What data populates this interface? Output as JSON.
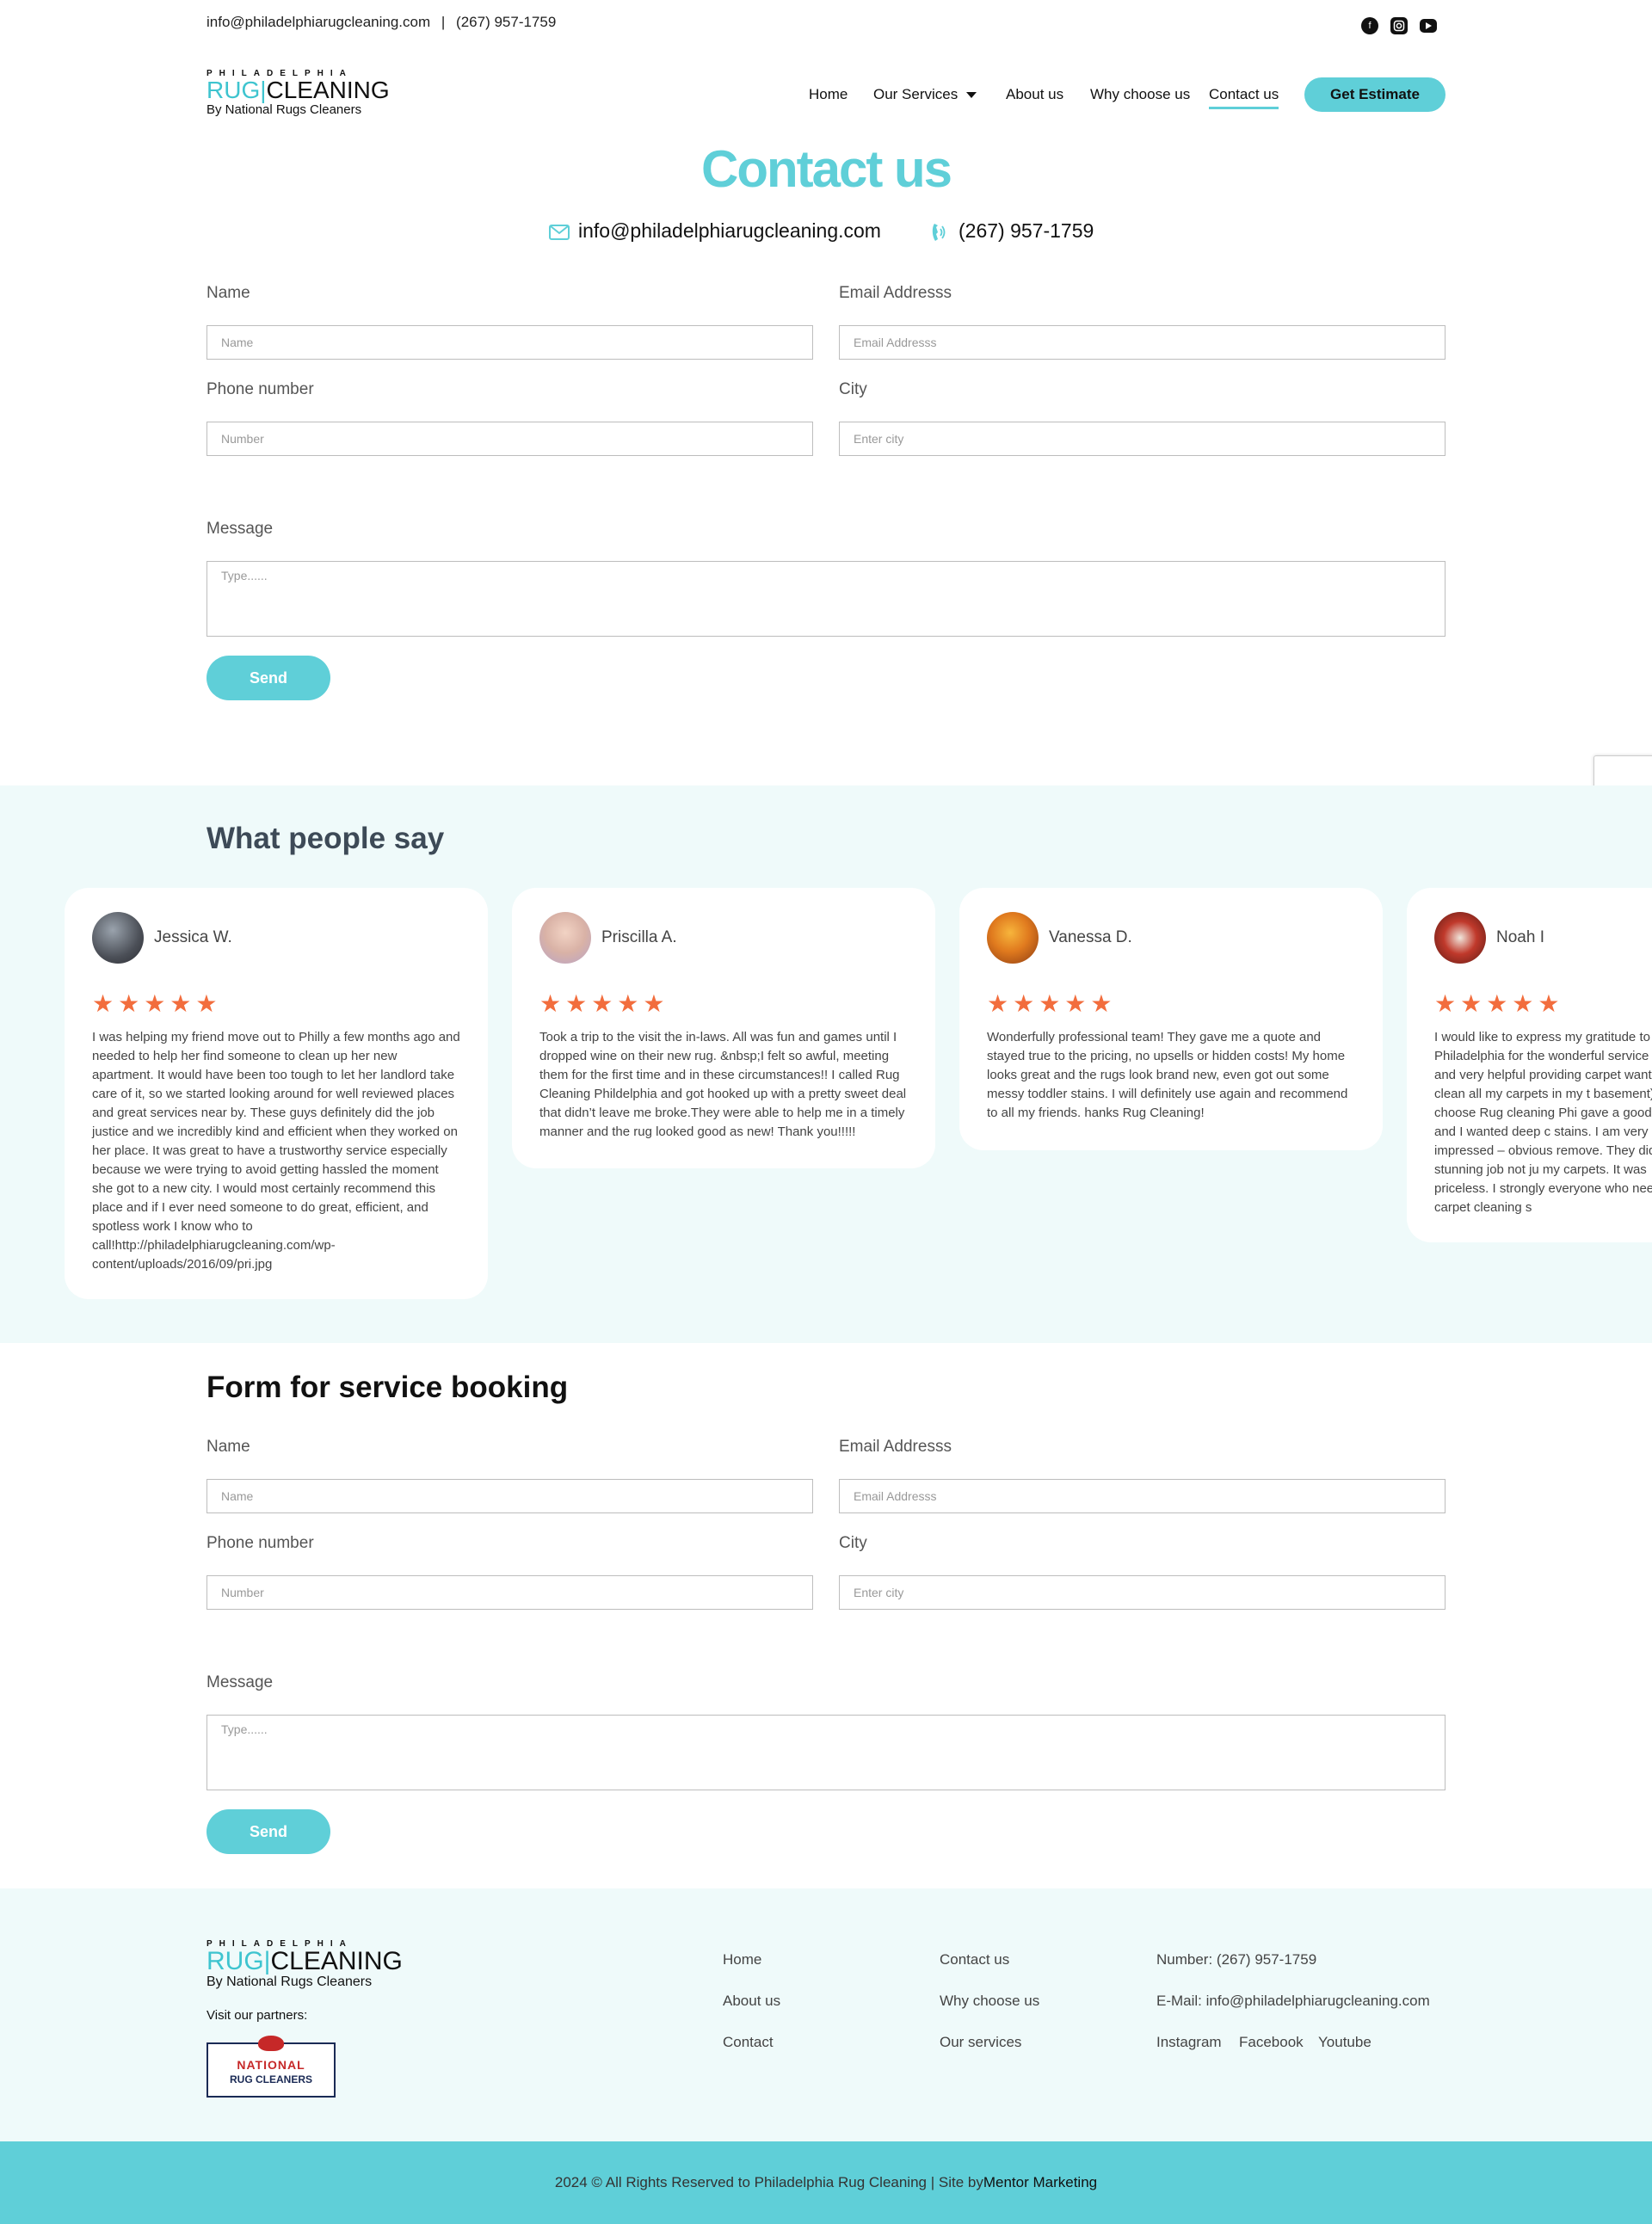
{
  "topbar": {
    "email": "info@philadelphiarugcleaning.com",
    "separator": "|",
    "phone": "(267) 957-1759",
    "social_icons": [
      "facebook-icon",
      "instagram-icon",
      "youtube-icon"
    ]
  },
  "logo": {
    "top": "PHILADELPHIA",
    "rug": "RUG",
    "cleaning": "CLEANING",
    "sub": "By National Rugs Cleaners"
  },
  "nav": {
    "items": [
      "Home",
      "Our Services",
      "About us",
      "Why choose us",
      "Contact us"
    ],
    "active": "Contact us",
    "cta": "Get Estimate"
  },
  "hero": {
    "title": "Contact us",
    "email": "info@philadelphiarugcleaning.com",
    "phone": "(267) 957-1759"
  },
  "contact_form": {
    "name_label": "Name",
    "name_placeholder": "Name",
    "email_label": "Email Addresss",
    "email_placeholder": "Email Addresss",
    "phone_label": "Phone number",
    "phone_placeholder": "Number",
    "city_label": "City",
    "city_placeholder": "Enter city",
    "message_label": "Message",
    "message_placeholder": "Type......",
    "send": "Send"
  },
  "testimonials": {
    "title": "What people say",
    "star_color": "#f26d3d",
    "reviews": [
      {
        "name": "Jessica W.",
        "stars": 5,
        "text": "I was helping my friend move out to Philly a few months ago and needed to help her find someone to clean up her new apartment. It would have been too tough to let her landlord take care of it, so we started looking around for well reviewed places and great services near by. These guys definitely did the job justice and we incredibly kind and efficient when they worked on her place. It was great to have a trustworthy service especially because we were trying to avoid getting hassled the moment she got to a new city. I would most certainly recommend this place and if I ever need someone to do great, efficient, and spotless work I know who to call!http://philadelphiarugcleaning.com/wp-content/uploads/2016/09/pri.jpg"
      },
      {
        "name": "Priscilla A.",
        "stars": 5,
        "text": "Took a trip to the visit the in-laws. All was fun and games until I dropped wine on their new rug. &nbsp;I felt so awful, meeting them for the first time and in these circumstances!! I called Rug Cleaning Phildelphia and got hooked up with a pretty sweet deal that didn’t leave me broke.They were able to help me in a timely manner and the rug looked good as new! Thank you!!!!!"
      },
      {
        "name": "Vanessa D.",
        "stars": 5,
        "text": "Wonderfully professional team! They gave me a quote and stayed true to the pricing, no upsells or hidden costs! My home looks great and the rugs look brand new, even got out some messy toddler stains. I will definitely use again and recommend to all my friends. hanks Rug Cleaning!"
      },
      {
        "name": "Noah I",
        "stars": 5,
        "text": "I would like to express my gratitude to Philadelphia for the wonderful service nice and very helpful providing carpet wanted to clean all my carpets in my t basement). I choose Rug cleaning Phi gave a good price and I wanted deep c stains. I am very impressed – obvious remove. They did a stunning job not ju my carpets. It was priceless. I strongly everyone who needs carpet cleaning s"
      }
    ]
  },
  "booking": {
    "title": "Form for service booking",
    "name_label": "Name",
    "name_placeholder": "Name",
    "email_label": "Email Addresss",
    "email_placeholder": "Email Addresss",
    "phone_label": "Phone number",
    "phone_placeholder": "Number",
    "city_label": "City",
    "city_placeholder": "Enter city",
    "message_label": "Message",
    "message_placeholder": "Type......",
    "send": "Send"
  },
  "footer": {
    "partners_label": "Visit our partners:",
    "partner_logo": {
      "top": "NATIONAL",
      "bottom": "RUG CLEANERS"
    },
    "col1": [
      "Home",
      "About us",
      "Contact"
    ],
    "col2": [
      "Contact us",
      "Why choose us",
      "Our services"
    ],
    "number": "Number: (267) 957-1759",
    "email": "E-Mail: info@philadelphiarugcleaning.com",
    "social": [
      "Instagram",
      "Facebook",
      "Youtube"
    ],
    "copyright": "2024 © All Rights Reserved to Philadelphia Rug Cleaning | Site by ",
    "credit": "Mentor Marketing"
  },
  "colors": {
    "accent": "#5fcfd8",
    "light_bg": "#effafa",
    "star": "#f26d3d"
  }
}
